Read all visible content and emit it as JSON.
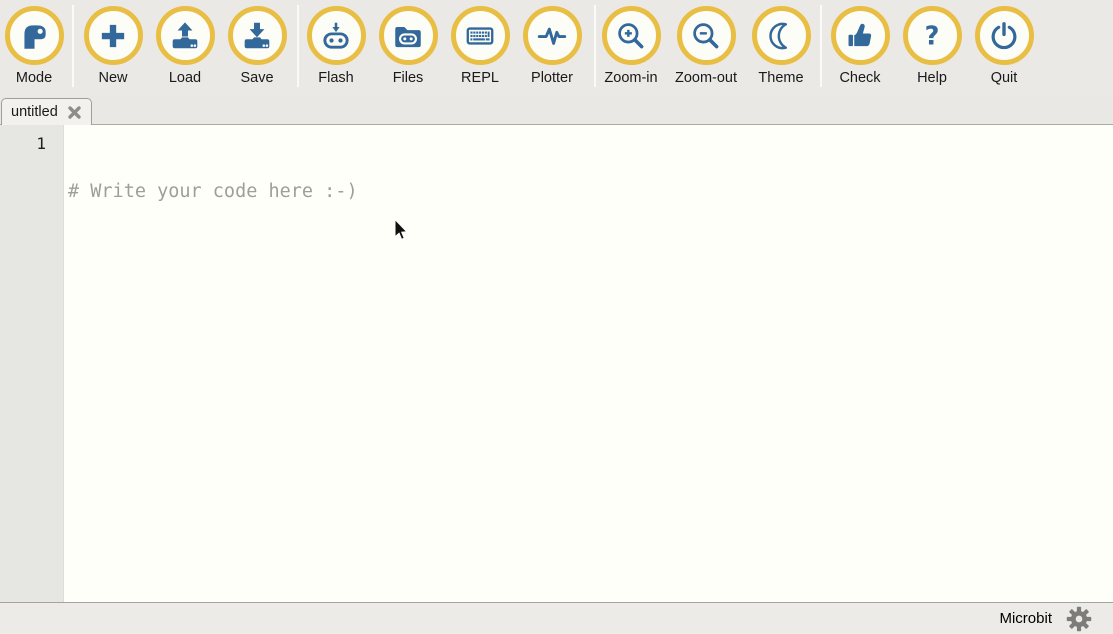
{
  "toolbar": {
    "buttons": [
      {
        "label": "Mode",
        "icon": "mode-icon"
      },
      {
        "label": "New",
        "icon": "new-icon"
      },
      {
        "label": "Load",
        "icon": "load-icon"
      },
      {
        "label": "Save",
        "icon": "save-icon"
      },
      {
        "label": "Flash",
        "icon": "flash-icon"
      },
      {
        "label": "Files",
        "icon": "files-icon"
      },
      {
        "label": "REPL",
        "icon": "repl-icon"
      },
      {
        "label": "Plotter",
        "icon": "plotter-icon"
      },
      {
        "label": "Zoom-in",
        "icon": "zoom-in-icon"
      },
      {
        "label": "Zoom-out",
        "icon": "zoom-out-icon"
      },
      {
        "label": "Theme",
        "icon": "theme-icon"
      },
      {
        "label": "Check",
        "icon": "check-icon"
      },
      {
        "label": "Help",
        "icon": "help-icon"
      },
      {
        "label": "Quit",
        "icon": "quit-icon"
      }
    ]
  },
  "tabs": [
    {
      "title": "untitled",
      "close_icon": "close-icon"
    }
  ],
  "editor": {
    "lines": [
      {
        "number": "1",
        "text": "# Write your code here :-)"
      }
    ]
  },
  "statusbar": {
    "mode_label": "Microbit",
    "settings_icon": "gear-icon"
  },
  "colors": {
    "ring_gold": "#E9BE45",
    "icon_blue": "#33689B",
    "toolbar_bg": "#EBE9E5",
    "editor_bg": "#FFFFFA",
    "gutter_bg": "#E6E6E2",
    "code_text": "#9E9E9A",
    "statusbar_bg": "#ECEBE7"
  }
}
